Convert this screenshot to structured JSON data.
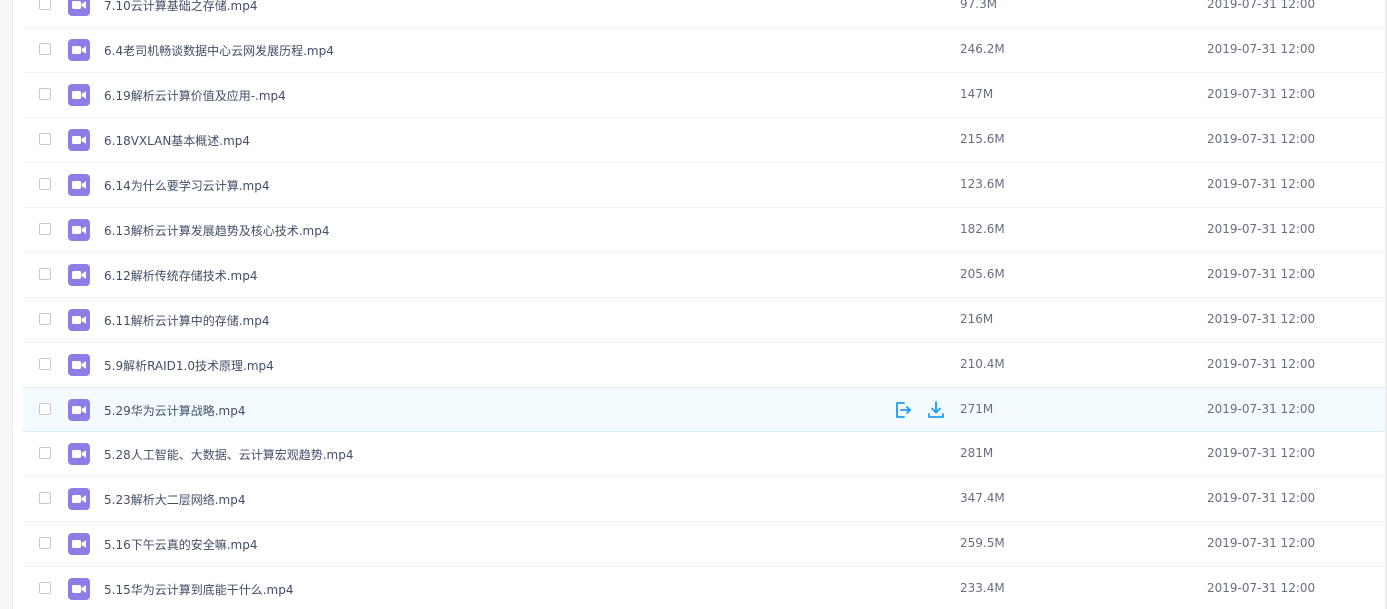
{
  "colors": {
    "video_icon": "#8d7ee7",
    "action_icon": "#1a9cf0",
    "hover_row": "#f4fbff"
  },
  "row_icon": "video-file-icon",
  "hover_actions": {
    "share_icon": "share-icon",
    "download_icon": "download-icon"
  },
  "files": [
    {
      "name": "7.10云计算基础之存储.mp4",
      "size": "97.3M",
      "date": "2019-07-31 12:00"
    },
    {
      "name": "6.4老司机畅谈数据中心云网发展历程.mp4",
      "size": "246.2M",
      "date": "2019-07-31 12:00"
    },
    {
      "name": "6.19解析云计算价值及应用-.mp4",
      "size": "147M",
      "date": "2019-07-31 12:00"
    },
    {
      "name": "6.18VXLAN基本概述.mp4",
      "size": "215.6M",
      "date": "2019-07-31 12:00"
    },
    {
      "name": "6.14为什么要学习云计算.mp4",
      "size": "123.6M",
      "date": "2019-07-31 12:00"
    },
    {
      "name": "6.13解析云计算发展趋势及核心技术.mp4",
      "size": "182.6M",
      "date": "2019-07-31 12:00"
    },
    {
      "name": "6.12解析传统存储技术.mp4",
      "size": "205.6M",
      "date": "2019-07-31 12:00"
    },
    {
      "name": "6.11解析云计算中的存储.mp4",
      "size": "216M",
      "date": "2019-07-31 12:00"
    },
    {
      "name": "5.9解析RAID1.0技术原理.mp4",
      "size": "210.4M",
      "date": "2019-07-31 12:00"
    },
    {
      "name": "5.29华为云计算战略.mp4",
      "size": "271M",
      "date": "2019-07-31 12:00",
      "hovered": true
    },
    {
      "name": "5.28人工智能、大数据、云计算宏观趋势.mp4",
      "size": "281M",
      "date": "2019-07-31 12:00"
    },
    {
      "name": "5.23解析大二层网络.mp4",
      "size": "347.4M",
      "date": "2019-07-31 12:00"
    },
    {
      "name": "5.16下午云真的安全嘛.mp4",
      "size": "259.5M",
      "date": "2019-07-31 12:00"
    },
    {
      "name": "5.15华为云计算到底能干什么.mp4",
      "size": "233.4M",
      "date": "2019-07-31 12:00"
    }
  ]
}
